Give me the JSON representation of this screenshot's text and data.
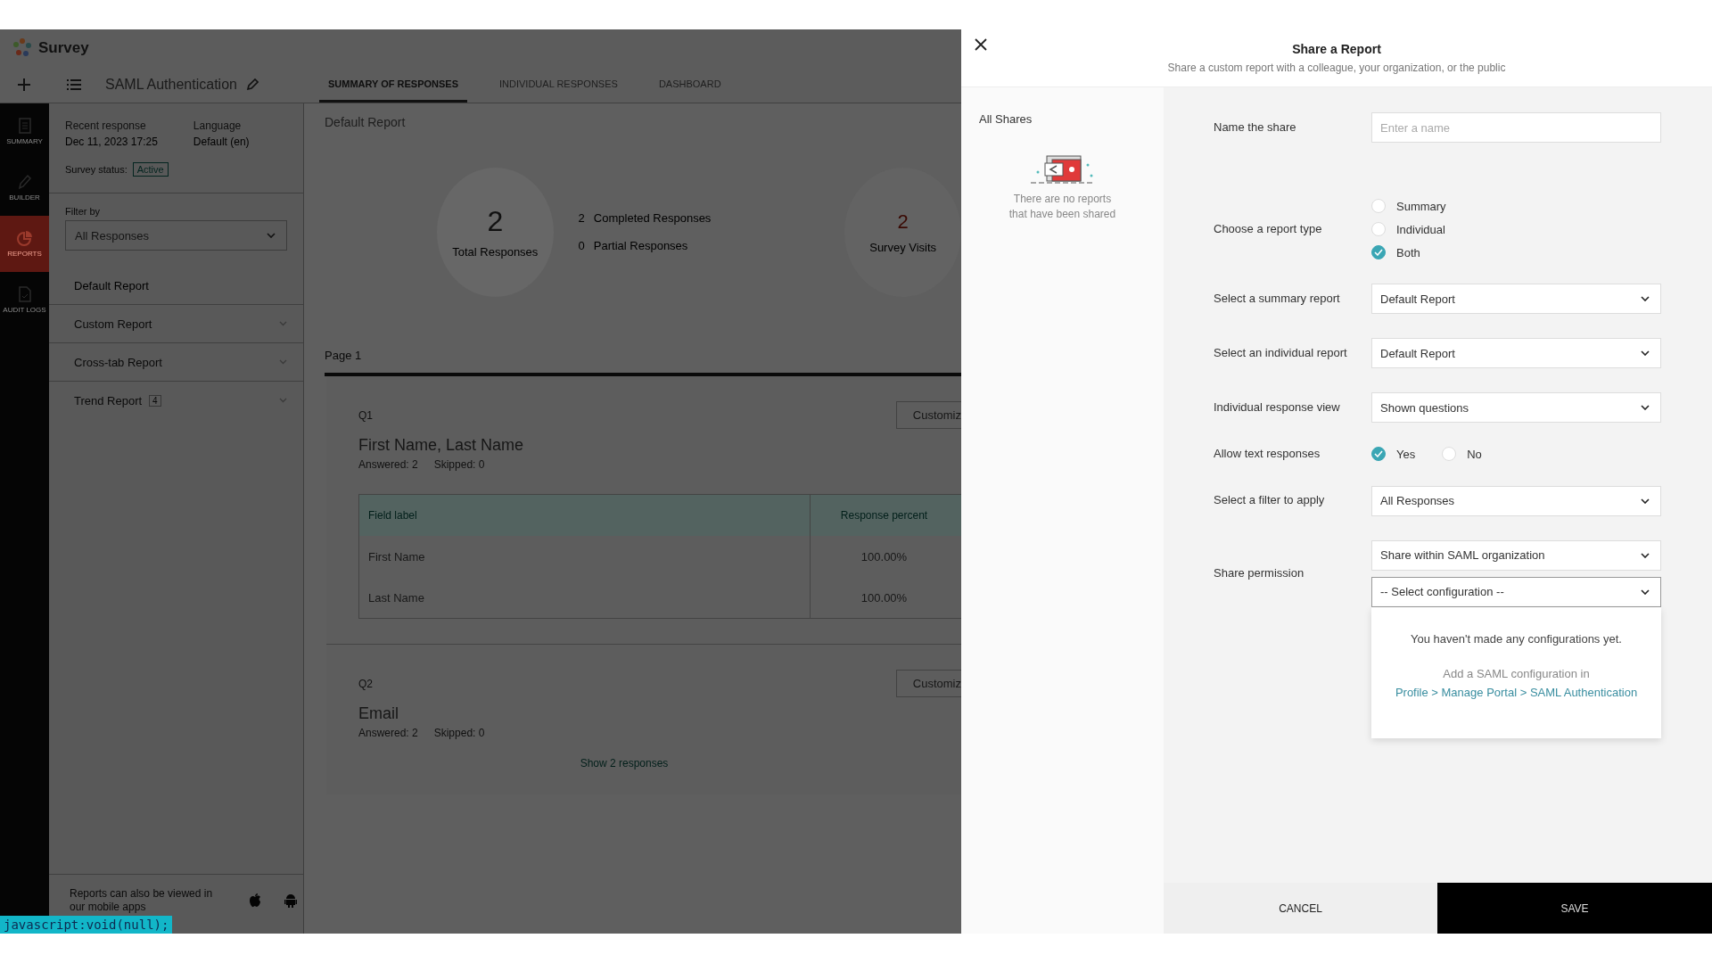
{
  "app": {
    "logo": "Survey",
    "survey_title": "SAML Authentication",
    "tabs": [
      {
        "label": "SUMMARY OF RESPONSES",
        "selected": true
      },
      {
        "label": "INDIVIDUAL RESPONSES",
        "selected": false
      },
      {
        "label": "DASHBOARD",
        "selected": false
      }
    ],
    "nav": [
      {
        "kind": "summary",
        "label": "SUMMARY",
        "selected": false
      },
      {
        "kind": "builder",
        "label": "BUILDER",
        "selected": false
      },
      {
        "kind": "reports",
        "label": "REPORTS",
        "selected": true
      },
      {
        "kind": "audit",
        "label": "AUDIT LOGS",
        "selected": false
      }
    ]
  },
  "survey_info": {
    "recent_label": "Recent response",
    "recent_value": "Dec 11, 2023 17:25",
    "language_label": "Language",
    "language_value": "Default (en)",
    "status_label": "Survey status:",
    "status_value": "Active"
  },
  "filter": {
    "label": "Filter by",
    "value": "All Responses"
  },
  "reports": [
    {
      "label": "Default Report",
      "expandable": false
    },
    {
      "label": "Custom Report",
      "expandable": true
    },
    {
      "label": "Cross-tab Report",
      "expandable": true
    },
    {
      "label": "Trend Report",
      "badge": "4",
      "expandable": true
    }
  ],
  "mobile_note": "Reports can also be viewed in our mobile apps",
  "report": {
    "title": "Default Report",
    "total": {
      "count": "2",
      "label": "Total Responses"
    },
    "completed": {
      "count": "2",
      "label": "Completed Responses"
    },
    "partial": {
      "count": "0",
      "label": "Partial Responses"
    },
    "visits": {
      "count": "2",
      "label": "Survey Visits"
    },
    "page": "Page 1",
    "questions": [
      {
        "number": "Q1",
        "customize": "Customiz",
        "title": "First Name, Last Name",
        "answered": "Answered: 2",
        "skipped": "Skipped: 0",
        "table": {
          "columns": [
            "Field label",
            "Response percent"
          ],
          "rows": [
            [
              "First Name",
              "100.00%"
            ],
            [
              "Last Name",
              "100.00%"
            ]
          ]
        }
      },
      {
        "number": "Q2",
        "customize": "Customiz",
        "title": "Email",
        "answered": "Answered: 2",
        "skipped": "Skipped: 0",
        "link": "Show 2 responses"
      }
    ]
  },
  "status_url": "javascript:void(null);",
  "share_dialog": {
    "title": "Share a Report",
    "subtitle": "Share a custom report with a colleague, your organization, or the public",
    "all_shares": "All Shares",
    "empty_text": "There are no reports that have been shared",
    "fields": [
      {
        "kind": "text",
        "label": "Name the share",
        "placeholder": "Enter a name"
      },
      {
        "kind": "radio",
        "label": "Choose a report type",
        "options": [
          {
            "label": "Summary",
            "selected": false
          },
          {
            "label": "Individual",
            "selected": false
          },
          {
            "label": "Both",
            "selected": true
          }
        ]
      },
      {
        "kind": "select",
        "label": "Select a summary report",
        "selects": [
          {
            "value": "Default Report",
            "expanded": false
          }
        ]
      },
      {
        "kind": "select",
        "label": "Select an individual report",
        "selects": [
          {
            "value": "Default Report",
            "expanded": false
          }
        ]
      },
      {
        "kind": "select",
        "label": "Individual response view",
        "selects": [
          {
            "value": "Shown questions",
            "expanded": false
          }
        ]
      },
      {
        "kind": "radio_inline",
        "label": "Allow text responses",
        "options": [
          {
            "label": "Yes",
            "selected": true
          },
          {
            "label": "No",
            "selected": false
          }
        ]
      },
      {
        "kind": "select",
        "label": "Select a filter to apply",
        "selects": [
          {
            "value": "All Responses",
            "expanded": false
          }
        ]
      },
      {
        "kind": "select",
        "label": "Share permission",
        "selects": [
          {
            "value": "Share within SAML organization",
            "expanded": false
          },
          {
            "value": "-- Select configuration --",
            "expanded": true
          }
        ]
      }
    ],
    "dropdown_message": "You haven't made any configurations yet.",
    "dropdown_hint": "Add a SAML configuration in",
    "dropdown_link": "Profile > Manage Portal > SAML Authentication",
    "cancel": "CANCEL",
    "save": "SAVE"
  }
}
